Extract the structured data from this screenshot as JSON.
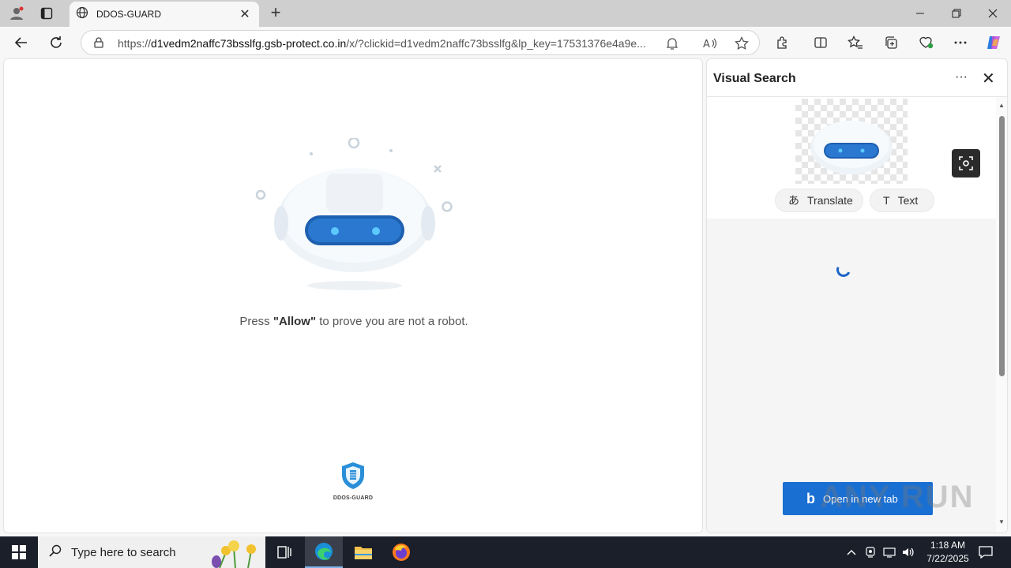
{
  "browser": {
    "tab_title": "DDOS-GUARD",
    "address": {
      "scheme": "https://",
      "host": "d1vedm2naffc73bsslfg.gsb-protect.co.in",
      "path": "/x/?clickid=d1vedm2naffc73bsslfg&lp_key=17531376e4a9e..."
    }
  },
  "page": {
    "press_prefix": "Press ",
    "press_bold": "\"Allow\"",
    "press_suffix": " to prove you are not a robot.",
    "logo_label": "DDOS-GUARD"
  },
  "panel": {
    "title": "Visual Search",
    "translate_label": "Translate",
    "text_label": "Text",
    "open_button_label": "Open in new tab",
    "watermark": "ANY RUN"
  },
  "taskbar": {
    "search_placeholder": "Type here to search",
    "time": "1:18 AM",
    "date": "7/22/2025"
  },
  "colors": {
    "accent": "#1a6fd2",
    "shield": "#2a8fd8",
    "robot_visor": "#1d5fb0"
  }
}
